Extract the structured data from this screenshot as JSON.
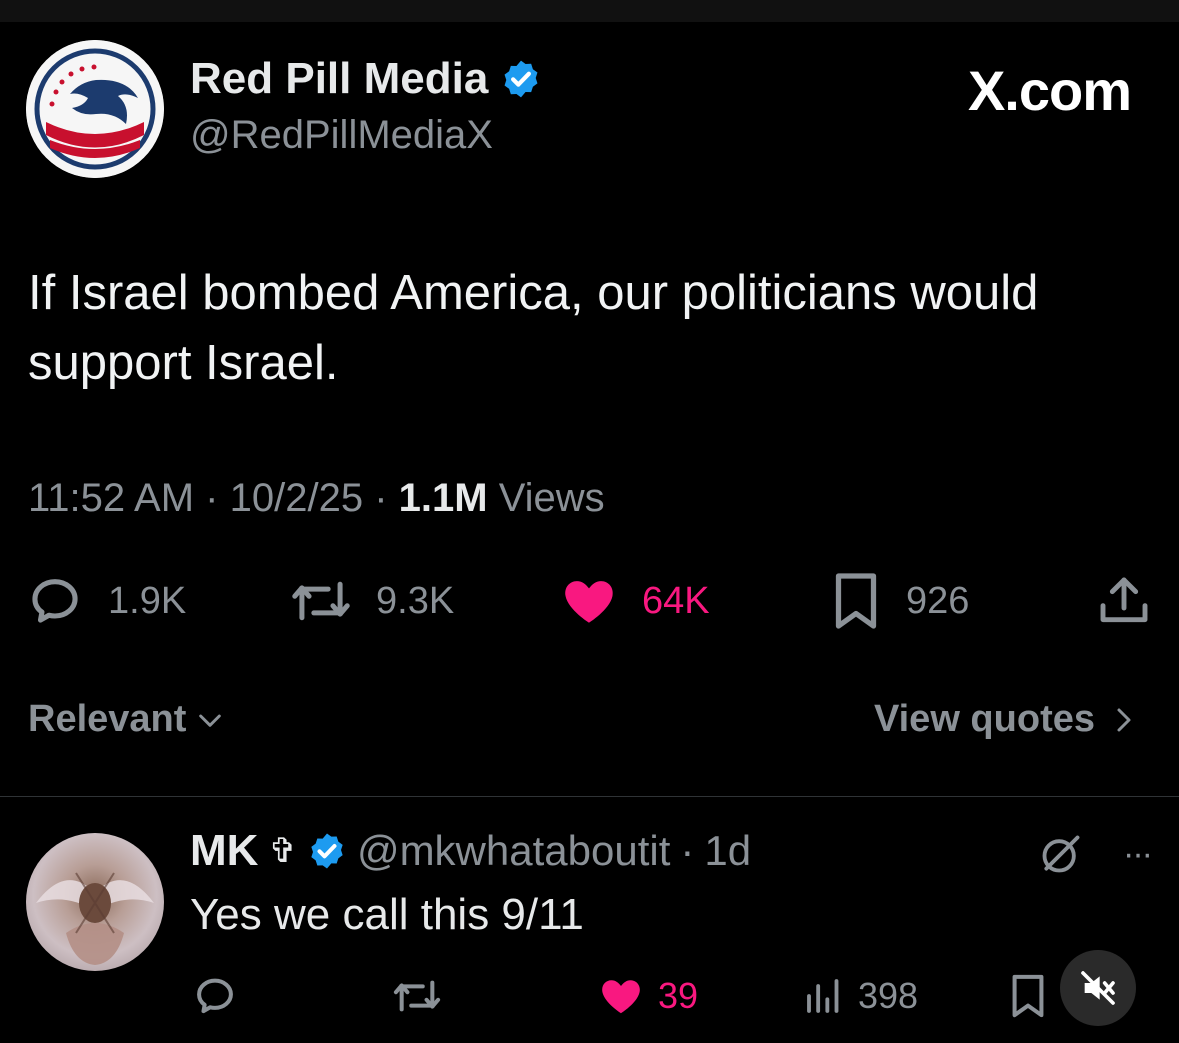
{
  "tweet": {
    "author_name": "Red Pill Media",
    "author_handle": "@RedPillMediaX",
    "brand": "X.com",
    "text": "If Israel bombed America, our politicians would support Israel.",
    "time": "11:52 AM",
    "date": "10/2/25",
    "views_count": "1.1M",
    "views_label": "Views",
    "replies": "1.9K",
    "reposts": "9.3K",
    "likes": "64K",
    "bookmarks": "926",
    "icons": [
      "verified-badge-icon",
      "reply-icon",
      "repost-icon",
      "heart-icon",
      "bookmark-icon",
      "share-icon"
    ]
  },
  "sort": {
    "label": "Relevant",
    "view_quotes": "View quotes"
  },
  "reply": {
    "name": "MK",
    "symbol": "✞",
    "handle": "@mkwhataboutit",
    "age": "1d",
    "text": "Yes we call this 9/11",
    "likes": "39",
    "views": "398",
    "more": "···",
    "icons": [
      "grok-icon",
      "more-icon",
      "reply-icon",
      "repost-icon",
      "heart-icon",
      "analytics-icon",
      "bookmark-icon",
      "mute-icon"
    ]
  },
  "colors": {
    "background": "#000000",
    "text": "#e7e9ea",
    "muted": "#8b9197",
    "like": "#f91880",
    "verified": "#1d9bf0",
    "divider": "#2f3336"
  }
}
